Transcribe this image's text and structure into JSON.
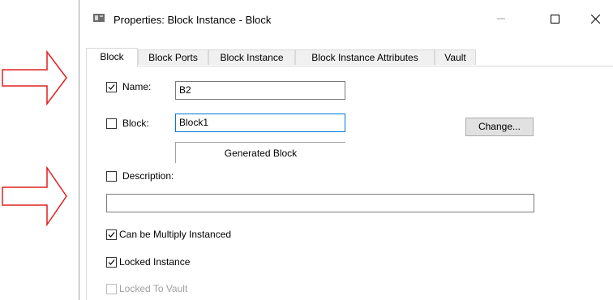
{
  "window": {
    "title": "Properties: Block Instance - Block",
    "controls": {
      "minimize": "minimize-icon",
      "maximize": "maximize-icon",
      "close": "close-icon"
    }
  },
  "tabs": [
    {
      "label": "Block",
      "active": true
    },
    {
      "label": "Block Ports",
      "active": false
    },
    {
      "label": "Block Instance",
      "active": false
    },
    {
      "label": "Block Instance Attributes",
      "active": false
    },
    {
      "label": "Vault",
      "active": false
    }
  ],
  "form": {
    "name": {
      "label": "Name:",
      "checked": true,
      "value": "B2"
    },
    "block": {
      "label": "Block:",
      "checked": false,
      "value": "Block1",
      "change_button": "Change..."
    },
    "generated_block_label": "Generated Block",
    "description": {
      "label": "Description:",
      "checked": false,
      "value": ""
    },
    "can_be_multiply_instanced": {
      "label": "Can be Multiply Instanced",
      "checked": true
    },
    "locked_instance": {
      "label": "Locked Instance",
      "checked": true
    },
    "locked_to_vault": {
      "label": "Locked To Vault",
      "checked": false,
      "disabled": true
    }
  },
  "annotations": {
    "arrow_color": "#e02020",
    "arrow_count": 2
  },
  "colors": {
    "focus_border": "#0078d7",
    "button_face": "#e1e1e1",
    "disabled_text": "#a0a0a0"
  }
}
